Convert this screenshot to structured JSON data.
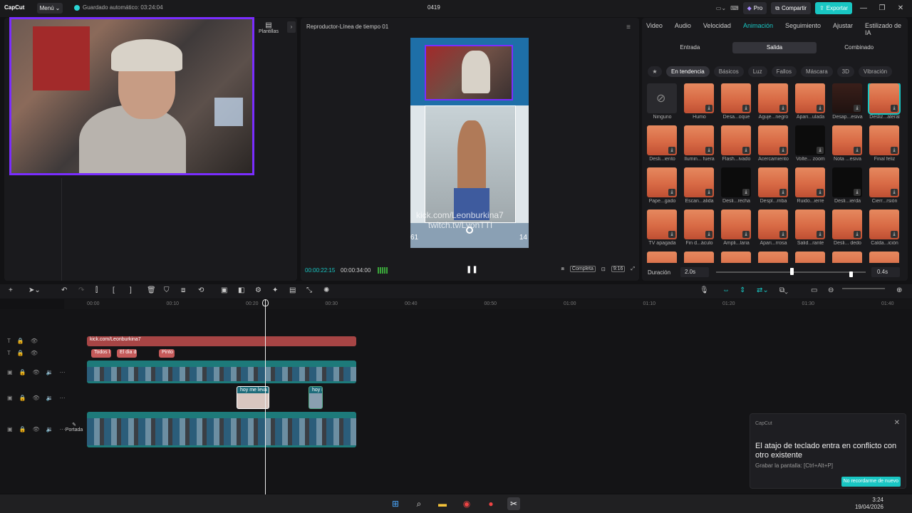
{
  "app": {
    "logo": "CapCut",
    "menu_label": "Menú",
    "autosave_text": "Guardado automático: 03:24:04",
    "project_title": "0419",
    "pro_label": "Pro",
    "share_label": "Compartir",
    "export_label": "Exportar"
  },
  "media": {
    "templates_label": "Plantillas"
  },
  "player": {
    "title": "Reproductor-Línea de tiempo 01",
    "overlay_line1": "kick.com/Leonburkina7",
    "overlay_line2": "twitch.tv/LyonTTI",
    "overlay_left": "61",
    "overlay_right": "14",
    "current_time": "00:00:22:15",
    "total_time": "00:00:34:00",
    "view_mode": "Completa",
    "aspect_ratio": "9:16"
  },
  "props": {
    "tabs": [
      "Video",
      "Audio",
      "Velocidad",
      "Animación",
      "Seguimiento",
      "Ajustar",
      "Estilizado de IA"
    ],
    "active_tab": "Animación",
    "subtabs": [
      "Entrada",
      "Salida",
      "Combinado"
    ],
    "active_subtab": "Salida",
    "chips": [
      "En tendencia",
      "Básicos",
      "Luz",
      "Fallos",
      "Máscara",
      "3D",
      "Vibración"
    ],
    "active_chip": "En tendencia",
    "effects": [
      "Ninguno",
      "Humo",
      "Desa...oque",
      "Aguje...negro",
      "Apari...ulada",
      "Desap...esiva",
      "Desliz...ateral",
      "Desli...iento",
      "Ilumin... fuera",
      "Flash...ivado",
      "Acercamiento",
      "Volte... zoom",
      "Nota ...esiva",
      "Final feliz",
      "Pape...gado",
      "Escan...alida",
      "Desli...recha",
      "Despl...rriba",
      "Ruido...ierre",
      "Desli...ierda",
      "Cierr...rsión",
      "TV apagada",
      "Fin d...áculo",
      "Ampli...laria",
      "Apari...rrosa",
      "Salid...rante",
      "Desli... dedo",
      "Calda...ición",
      "",
      "",
      "",
      "",
      "",
      "",
      ""
    ],
    "duration_label": "Duración",
    "duration_value": "2.0s",
    "duration_value2": "0.4s"
  },
  "ruler": {
    "ticks": [
      "00:00",
      "00:10",
      "00:20",
      "00:30",
      "00:40",
      "00:50",
      "01:00",
      "01:10",
      "01:20",
      "01:30",
      "01:40"
    ]
  },
  "timeline": {
    "text_clip": "kick.com/Leonburkina7",
    "subtitle_clips": [
      "Todos l",
      "El dia d",
      "Pinto"
    ],
    "video_clip_1": "clip_01KPHZNNJF18FSFQHESS39SSSV.mp4",
    "video_clip_1_duration": "00:00:34:00",
    "overlay_clips": [
      "hoy me leva",
      "hoy m"
    ],
    "video_clip_2": "clip_01KPHZNNJF18FSFQHESS39SSSV.mp4",
    "video_clip_2_duration": "00:00:34:00",
    "cover_label": "Portada"
  },
  "toast": {
    "app": "CapCut",
    "message": "El atajo de teclado entra en conflicto con otro existente",
    "hint": "Grabar la pantalla: [Ctrl+Alt+P]",
    "button": "No recordarme de nuevo"
  },
  "taskbar": {
    "time": "3:24",
    "date": "19/04/2026"
  },
  "colors": {
    "accent": "#19c6c3",
    "webcam_border": "#7a2dff",
    "text_track": "#a74545"
  }
}
